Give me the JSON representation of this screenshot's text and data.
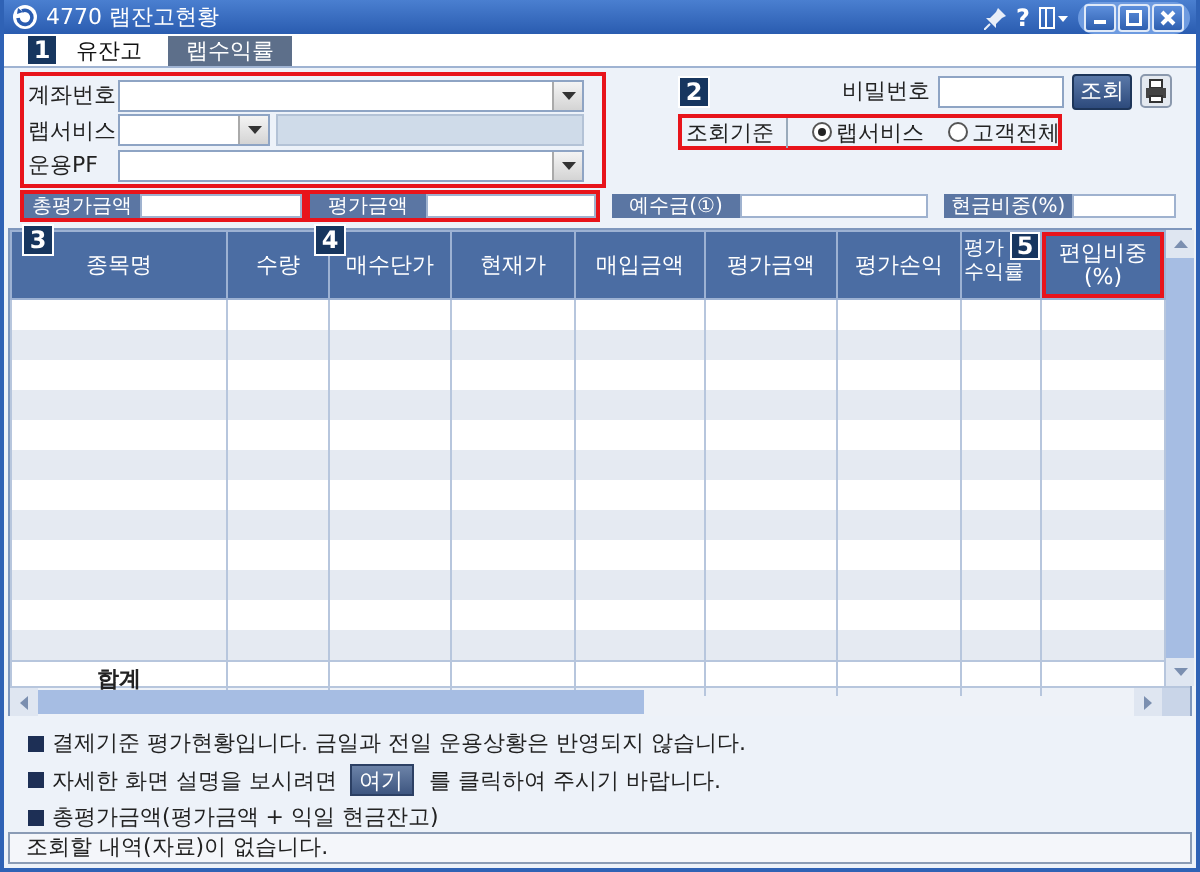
{
  "window": {
    "title": "4770 랩잔고현황",
    "help": "?"
  },
  "tabs": [
    {
      "label": "유잔고",
      "selected": true
    },
    {
      "label": "랩수익률",
      "selected": false
    }
  ],
  "markers": {
    "tabs": "1",
    "search_basis": "2",
    "total_eval": "3",
    "eval_amount": "4",
    "weight_column": "5"
  },
  "form": {
    "highlighted": true,
    "account": {
      "label": "계좌번호"
    },
    "wrap_service": {
      "label": "랩서비스",
      "detail_disabled": true
    },
    "portfolio": {
      "label": "운용PF"
    },
    "password": {
      "label": "비밀번호"
    },
    "query_button": "조회",
    "search_basis": {
      "label": "조회기준",
      "highlighted": true,
      "options": [
        {
          "label": "랩서비스",
          "selected": true
        },
        {
          "label": "고객전체",
          "selected": false
        }
      ]
    }
  },
  "summary": [
    {
      "label": "총평가금액",
      "highlighted": true
    },
    {
      "label": "평가금액",
      "highlighted": true
    },
    {
      "label": "예수금(①)",
      "highlighted": false
    },
    {
      "label": "현금비중(%)",
      "highlighted": false
    }
  ],
  "table": {
    "columns": [
      {
        "label": "종목명",
        "highlighted": false
      },
      {
        "label": "수량",
        "highlighted": false
      },
      {
        "label": "매수단가",
        "highlighted": false
      },
      {
        "label": "현재가",
        "highlighted": false
      },
      {
        "label": "매입금액",
        "highlighted": false
      },
      {
        "label": "평가금액",
        "highlighted": false
      },
      {
        "label": "평가손익",
        "highlighted": false
      },
      {
        "label": "평가\n수익률",
        "highlighted": false
      },
      {
        "label": "편입비중\n(%)",
        "highlighted": true
      }
    ],
    "total_row": {
      "label": "합계"
    }
  },
  "notes": [
    {
      "text": "결제기준 평가현황입니다. 금일과 전일 운용상황은 반영되지 않습니다."
    },
    {
      "before": "자세한 화면 설명을 보시려면",
      "button": "여기",
      "after": "를 클릭하여 주시기 바랍니다."
    },
    {
      "text": "총평가금액(평가금액 + 익일 현금잔고)"
    }
  ],
  "status_bar": "조회할 내역(자료)이 없습니다."
}
